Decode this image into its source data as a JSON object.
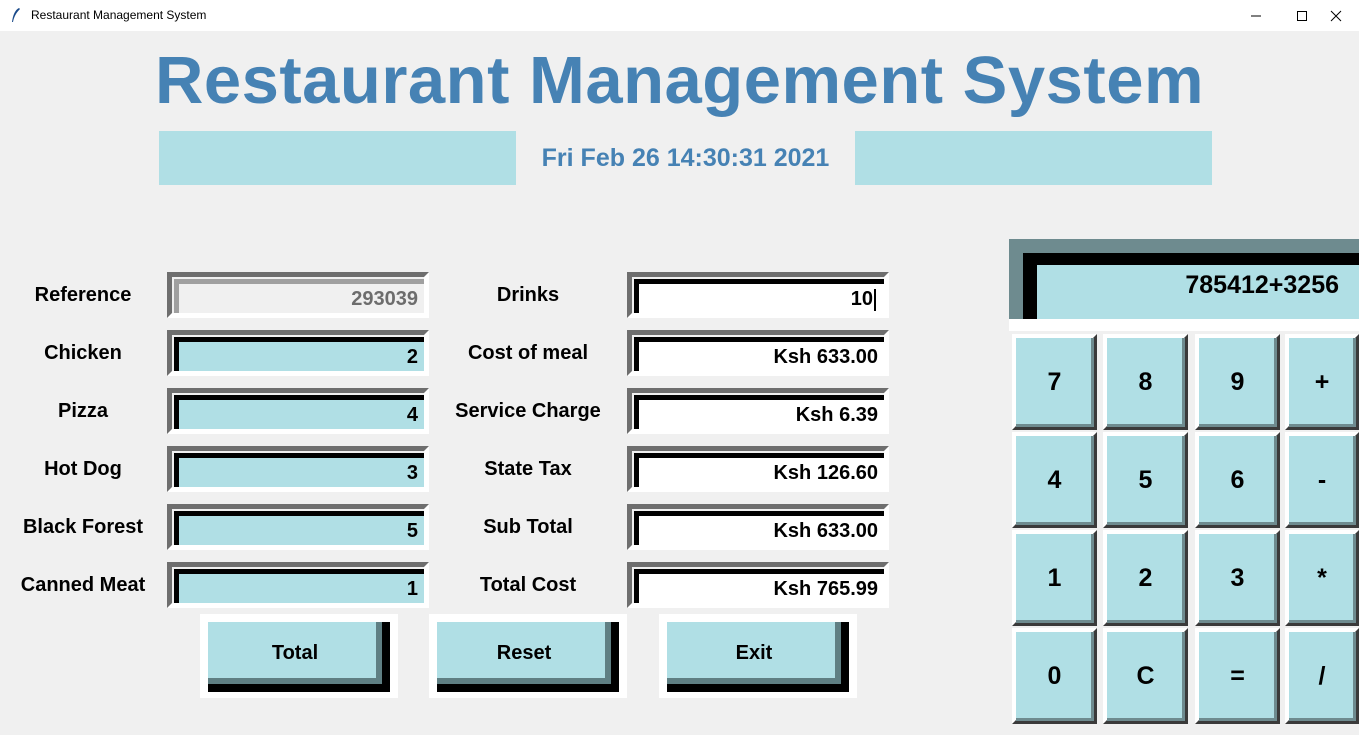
{
  "window": {
    "title": "Restaurant Management System"
  },
  "header": {
    "title": "Restaurant Management System",
    "datetime": "Fri Feb 26 14:30:31 2021"
  },
  "order": {
    "reference": {
      "label": "Reference",
      "value": "293039"
    },
    "chicken": {
      "label": "Chicken",
      "value": "2"
    },
    "pizza": {
      "label": "Pizza",
      "value": "4"
    },
    "hot_dog": {
      "label": "Hot Dog",
      "value": "3"
    },
    "black_forest": {
      "label": "Black Forest",
      "value": "5"
    },
    "canned_meat": {
      "label": "Canned Meat",
      "value": "1"
    }
  },
  "costs": {
    "drinks": {
      "label": "Drinks",
      "value": "10"
    },
    "cost_of_meal": {
      "label": "Cost of meal",
      "value": "Ksh 633.00"
    },
    "service_charge": {
      "label": "Service Charge",
      "value": "Ksh 6.39"
    },
    "state_tax": {
      "label": "State Tax",
      "value": "Ksh 126.60"
    },
    "sub_total": {
      "label": "Sub Total",
      "value": "Ksh 633.00"
    },
    "total_cost": {
      "label": "Total Cost",
      "value": "Ksh 765.99"
    }
  },
  "actions": {
    "total": "Total",
    "reset": "Reset",
    "exit": "Exit"
  },
  "calculator": {
    "display": "785412+3256",
    "keys": [
      "7",
      "8",
      "9",
      "+",
      "4",
      "5",
      "6",
      "-",
      "1",
      "2",
      "3",
      "*",
      "0",
      "C",
      "=",
      "/"
    ]
  },
  "colors": {
    "title": "#4682b4",
    "field_fill": "#b0dfe5",
    "background": "#f0f0f0"
  }
}
